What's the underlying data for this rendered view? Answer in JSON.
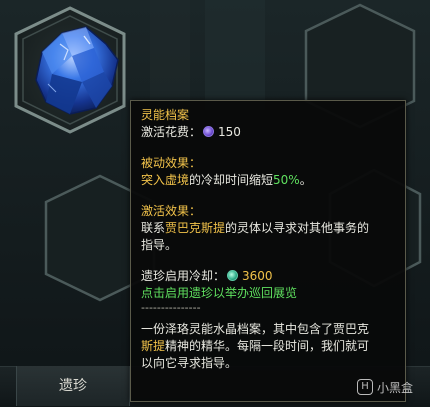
{
  "bottom_tab_label": "遗珍",
  "tooltip": {
    "title": "灵能档案",
    "activation_cost_label": "激活花费：",
    "activation_cost_value": "150",
    "passive_header": "被动效果：",
    "passive_name": "突入虚境",
    "passive_text": "的冷却时间缩短",
    "passive_percent": "50%",
    "passive_end": "。",
    "active_header": "激活效果：",
    "active_line1_pre": "联系",
    "active_name": "贾巴克斯提",
    "active_line1_post": "的灵体以寻求对其他事务的",
    "active_line2": "指导。",
    "relic_cd_label": "遗珍启用冷却：",
    "relic_cd_value": "3600",
    "relic_hint": "点击启用遗珍以举办巡回展览",
    "divider": "---------------",
    "desc_line1": "一份泽珞灵能水晶档案，其中包含了贾巴克",
    "desc_line2_name": "斯提",
    "desc_line2_rest": "精神的精华。每隔一段时间，我们就可",
    "desc_line3": "以向它寻求指导。"
  },
  "watermark": {
    "text": "小黑盒",
    "logo": "H"
  },
  "colors": {
    "highlight_gold": "#f1c24a",
    "highlight_green": "#5fe05f",
    "crystal_blue": "#2a5fd6",
    "hex_border": "#5d6e6e"
  },
  "icons": [
    "crystal-relic-icon",
    "purple-token-icon",
    "teal-token-icon"
  ]
}
